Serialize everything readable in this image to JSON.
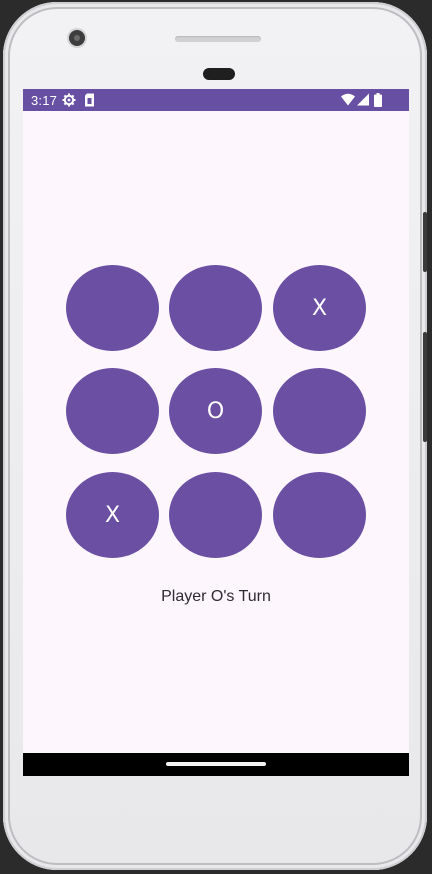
{
  "status_bar": {
    "time": "3:17",
    "left_icons": [
      "gear-icon",
      "sim-card-icon"
    ],
    "right_icons": [
      "wifi-icon",
      "cell-signal-icon",
      "battery-icon"
    ],
    "color": "#6750a4"
  },
  "board": {
    "cells": [
      "",
      "",
      "X",
      "",
      "O",
      "",
      "X",
      "",
      ""
    ],
    "cell_color": "#6a4fa3",
    "mark_color": "#ffffff"
  },
  "status": {
    "turn_text": "Player O's Turn"
  },
  "colors": {
    "background": "#fdf6fd",
    "navigation_bar": "#000000"
  }
}
